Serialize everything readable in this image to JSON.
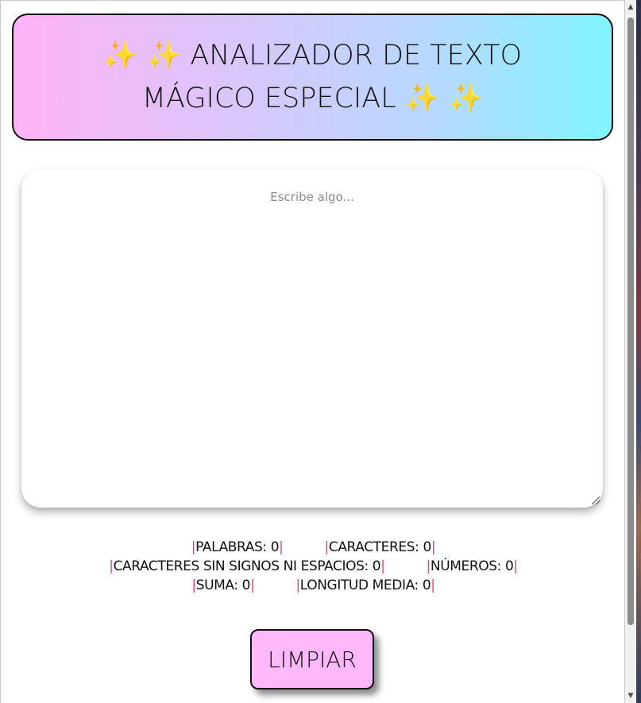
{
  "header": {
    "sparkles_left": "✨ ✨",
    "title": "ANALIZADOR DE TEXTO MÁGICO ESPECIAL",
    "sparkles_right": "✨ ✨"
  },
  "input": {
    "placeholder": "Escribe algo...",
    "value": ""
  },
  "stats": {
    "words_label": "PALABRAS: 0",
    "chars_label": "CARACTERES: 0",
    "chars_no_signs_label": "CARACTERES SIN SIGNOS NI ESPACIOS: 0",
    "numbers_label": "NÚMEROS: 0",
    "sum_label": "SUMA: 0",
    "avg_length_label": "LONGITUD MEDIA: 0",
    "separator": "|"
  },
  "actions": {
    "clear_label": "LIMPIAR"
  },
  "scrollbar": {
    "up_icon": "▲",
    "down_icon": "▼"
  },
  "colors": {
    "header_gradient_start": "#ffb3f6",
    "header_gradient_end": "#80f5ff",
    "button_bg": "#ffb8fb",
    "separator": "#e0457b",
    "sparkle": "#f2c232"
  }
}
